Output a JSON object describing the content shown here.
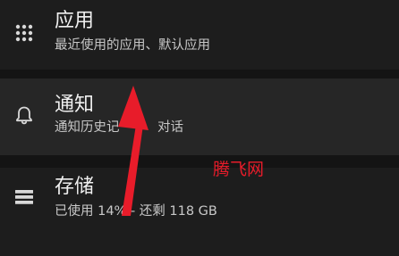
{
  "settings": {
    "items": [
      {
        "icon": "apps-grid-icon",
        "title": "应用",
        "subtitle": "最近使用的应用、默认应用"
      },
      {
        "icon": "bell-icon",
        "title": "通知",
        "subtitle_left": "通知历史记",
        "subtitle_right": "对话"
      },
      {
        "icon": "storage-icon",
        "title": "存储",
        "subtitle": "已使用 14%  - 还剩 118 GB"
      }
    ]
  },
  "overlay": {
    "watermark": "腾飞网",
    "arrow_color": "#e81c2a"
  },
  "colors": {
    "background": "#1b1b1b",
    "highlight_row": "#262626",
    "text_primary": "#f0f0f0",
    "text_secondary": "#c8c8c8",
    "accent_red": "#e81c2a"
  }
}
